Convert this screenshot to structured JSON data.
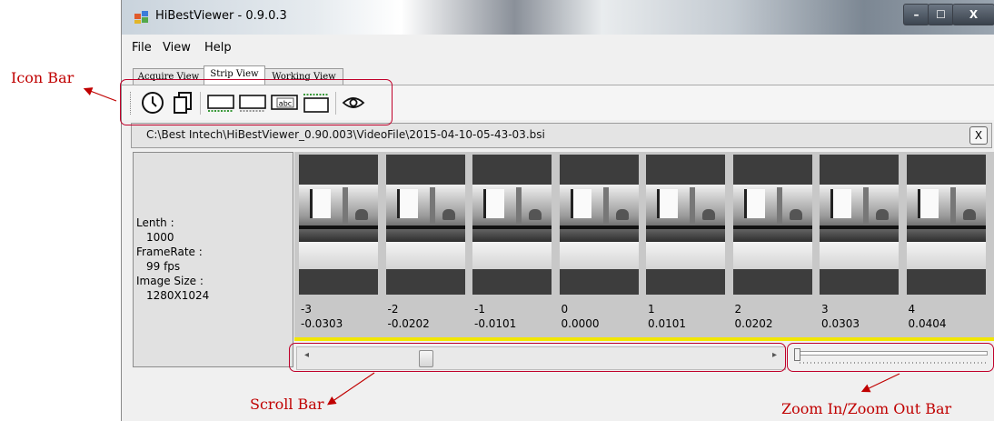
{
  "window": {
    "title": "HiBestViewer - 0.9.0.3",
    "controls": {
      "minimize": "–",
      "maximize": "☐",
      "close": "X"
    }
  },
  "menu": [
    "File",
    "View",
    "Help"
  ],
  "tabs": [
    {
      "label": "Acquire View",
      "selected": false
    },
    {
      "label": "Strip View",
      "selected": true
    },
    {
      "label": "Working View",
      "selected": false
    }
  ],
  "toolbar": {
    "icons": [
      "clock-icon",
      "copy-pages-icon",
      "frame-strip-icon",
      "frame-strip-alt-icon",
      "abc-label-icon",
      "ruler-frame-icon",
      "eye-icon"
    ],
    "abc_text": "abc"
  },
  "path": {
    "text": "C:\\Best Intech\\HiBestViewer_0.90.003\\VideoFile\\2015-04-10-05-43-03.bsi",
    "close_label": "X"
  },
  "info": {
    "length_label": "Lenth :",
    "length_value": "1000",
    "framerate_label": "FrameRate :",
    "framerate_value": "99 fps",
    "imagesize_label": "Image Size :",
    "imagesize_value": "1280X1024"
  },
  "frames": [
    {
      "index": "-3",
      "time": "-0.0303"
    },
    {
      "index": "-2",
      "time": "-0.0202"
    },
    {
      "index": "-1",
      "time": "-0.0101"
    },
    {
      "index": "0",
      "time": "0.0000"
    },
    {
      "index": "1",
      "time": "0.0101"
    },
    {
      "index": "2",
      "time": "0.0202"
    },
    {
      "index": "3",
      "time": "0.0303"
    },
    {
      "index": "4",
      "time": "0.0404"
    }
  ],
  "scrollbar": {
    "left_arrow": "◂",
    "right_arrow": "▸",
    "position": 0.24
  },
  "zoom": {
    "level": 0.0
  },
  "annotations": {
    "icon_bar": "Icon Bar",
    "scroll_bar": "Scroll Bar",
    "zoom_bar": "Zoom In/Zoom Out Bar",
    "color": "#c00000"
  },
  "colors": {
    "highlight_line": "#f2e600",
    "annotation": "#c00000"
  }
}
